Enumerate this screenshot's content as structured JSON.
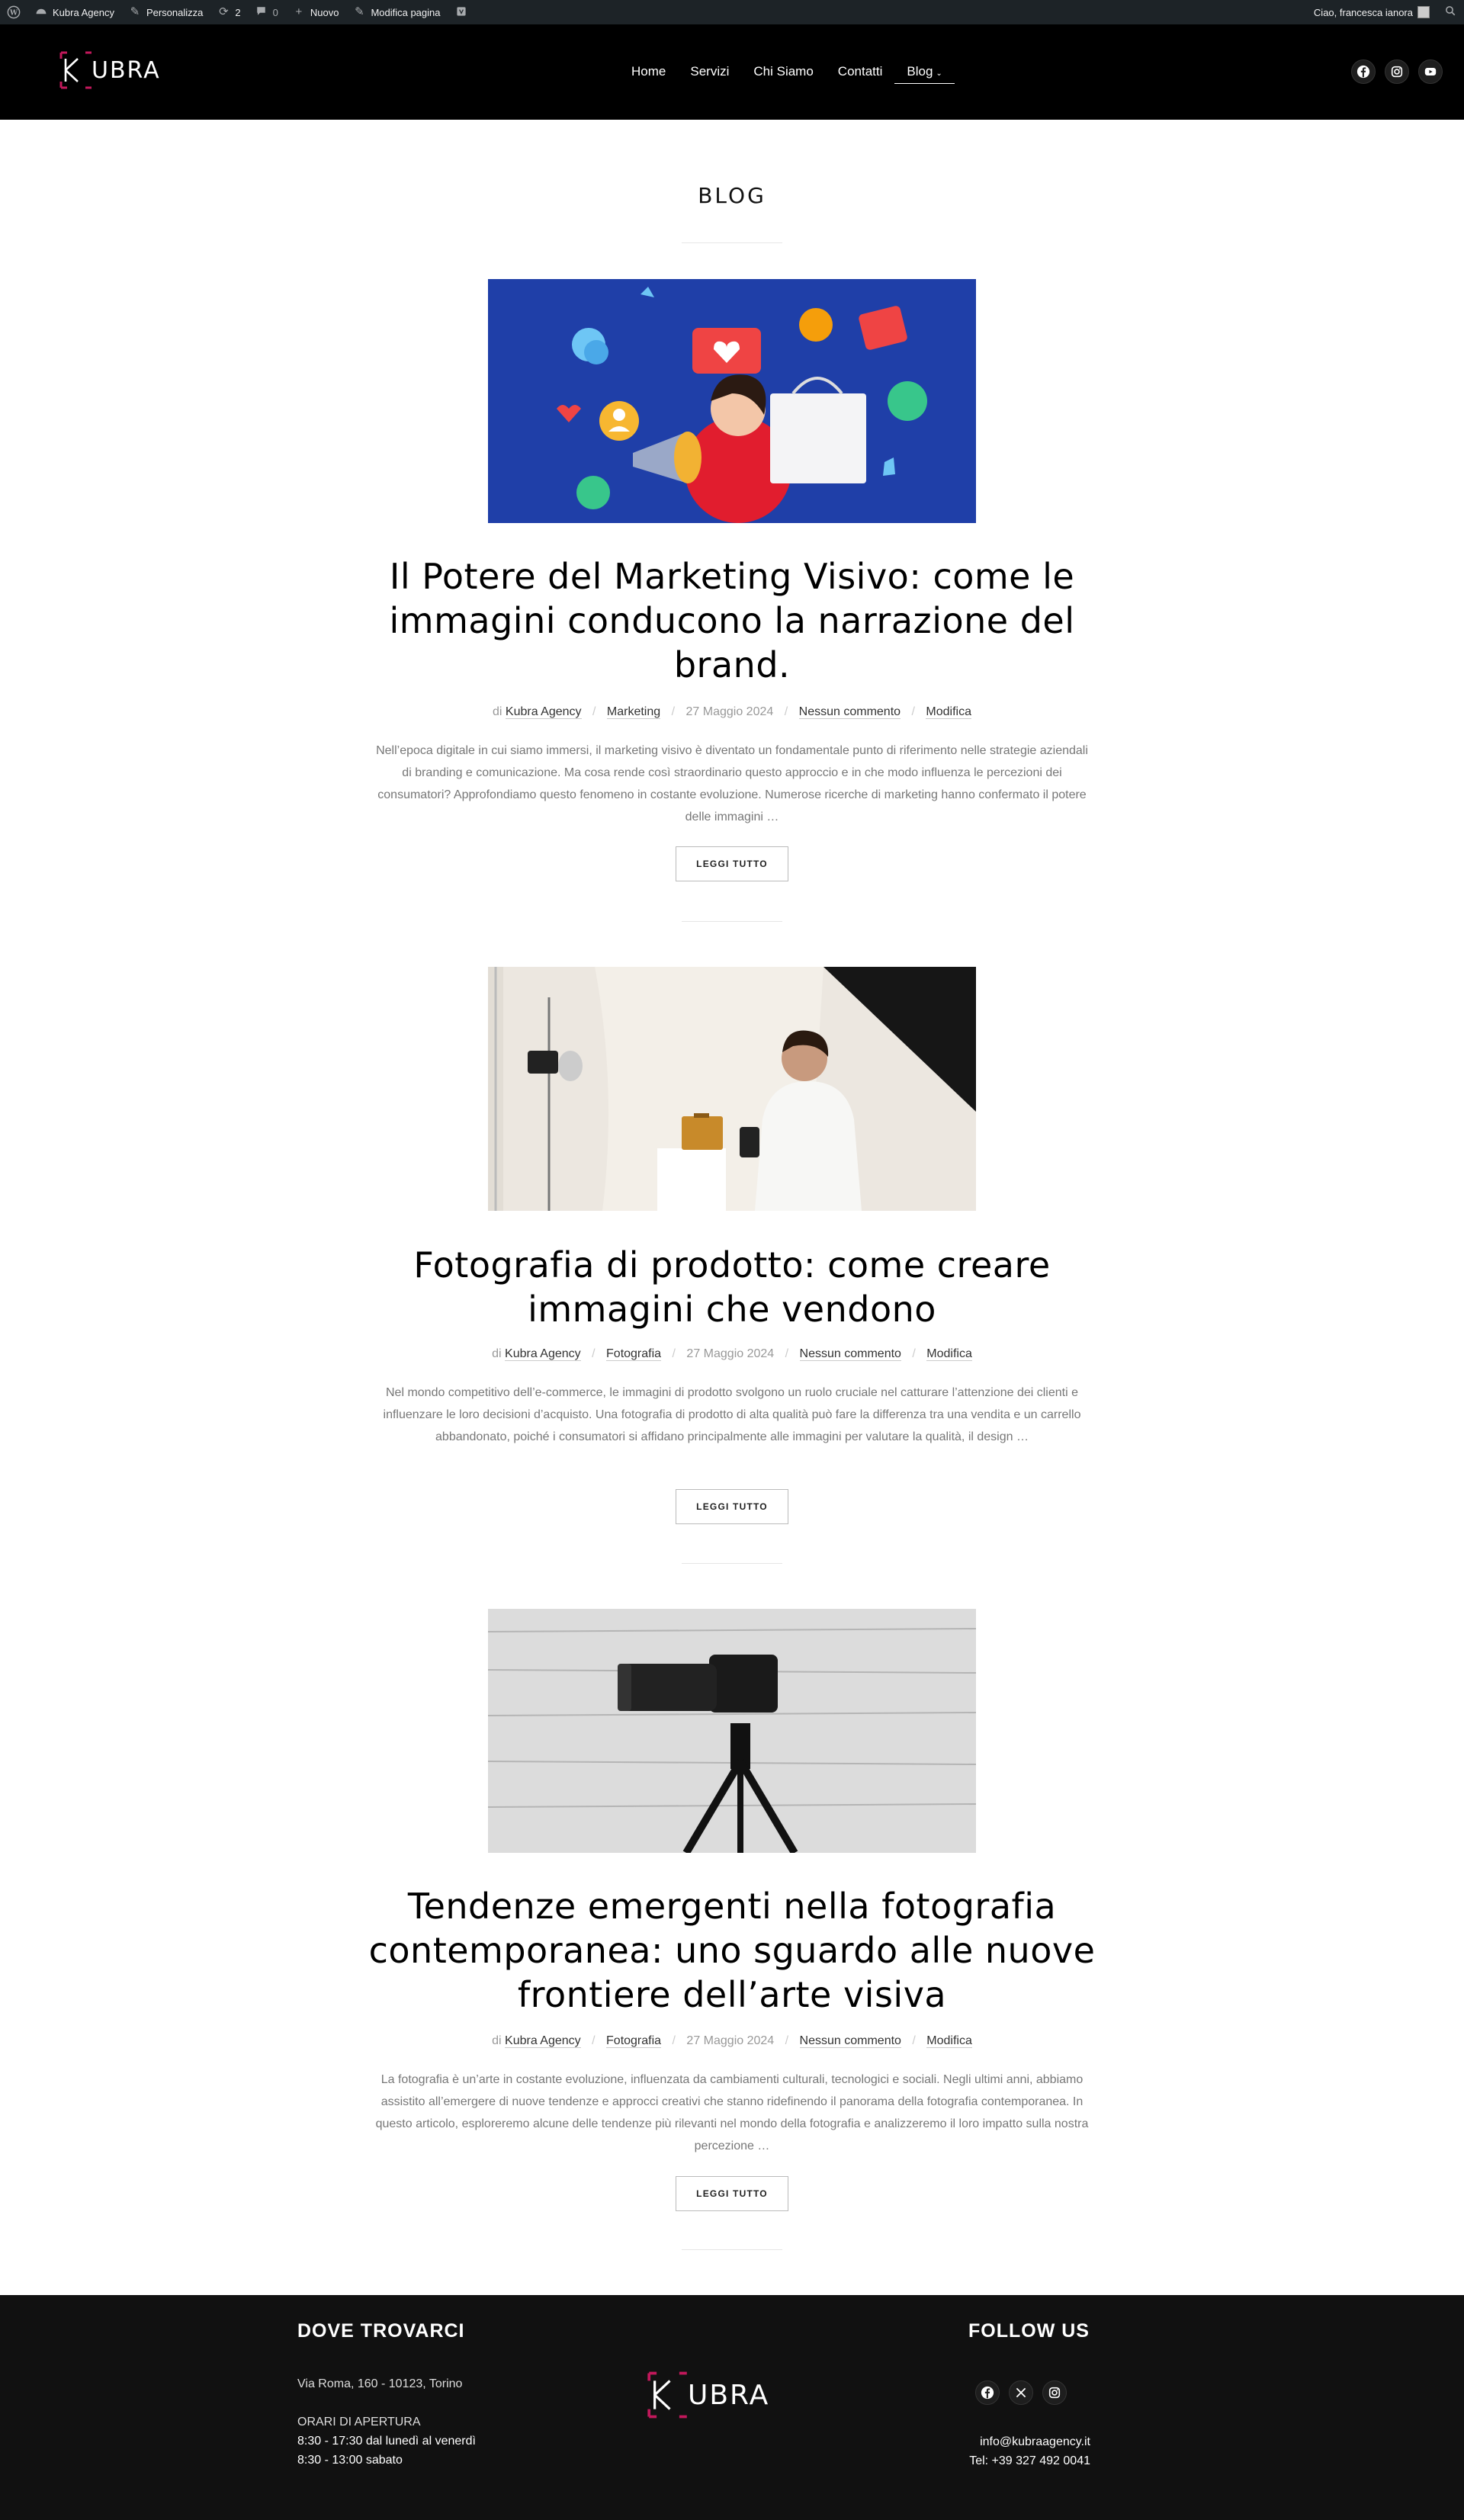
{
  "admin_bar": {
    "site_name": "Kubra Agency",
    "customize": "Personalizza",
    "updates_count": "2",
    "comments_count": "0",
    "new": "Nuovo",
    "edit_page": "Modifica pagina",
    "greeting": "Ciao, francesca ianora"
  },
  "header": {
    "logo_text": "UBRA",
    "nav": [
      {
        "label": "Home"
      },
      {
        "label": "Servizi"
      },
      {
        "label": "Chi Siamo"
      },
      {
        "label": "Contatti"
      },
      {
        "label": "Blog"
      }
    ],
    "socials": [
      "facebook-icon",
      "instagram-icon",
      "youtube-icon"
    ]
  },
  "page": {
    "title": "BLOG"
  },
  "posts": [
    {
      "title": "Il Potere del Marketing Visivo: come le immagini conducono la narrazione del brand.",
      "by": "di",
      "author": "Kubra Agency",
      "category": "Marketing",
      "date": "27 Maggio 2024",
      "comments": "Nessun commento",
      "edit": "Modifica",
      "excerpt": "Nell’epoca digitale in cui siamo immersi, il marketing visivo è diventato un fondamentale punto di riferimento nelle strategie aziendali di branding e comunicazione. Ma cosa rende così straordinario questo approccio e in che modo influenza le percezioni dei consumatori? Approfondiamo questo fenomeno in costante evoluzione. Numerose ricerche di marketing hanno confermato il potere delle immagini …",
      "button": "LEGGI TUTTO"
    },
    {
      "title": "Fotografia di prodotto: come creare immagini che vendono",
      "by": "di",
      "author": "Kubra Agency",
      "category": "Fotografia",
      "date": "27 Maggio 2024",
      "comments": "Nessun commento",
      "edit": "Modifica",
      "excerpt": "Nel mondo competitivo dell’e-commerce, le immagini di prodotto svolgono un ruolo cruciale nel catturare l’attenzione dei clienti e influenzare le loro decisioni d’acquisto. Una fotografia di prodotto di alta qualità può fare la differenza tra una vendita e un carrello abbandonato, poiché i consumatori si affidano principalmente alle immagini per valutare la qualità, il design …",
      "button": "LEGGI TUTTO"
    },
    {
      "title": "Tendenze emergenti nella fotografia contemporanea: uno sguardo alle nuove frontiere dell’arte visiva",
      "by": "di",
      "author": "Kubra Agency",
      "category": "Fotografia",
      "date": "27 Maggio 2024",
      "comments": "Nessun commento",
      "edit": "Modifica",
      "excerpt": "La fotografia è un’arte in costante evoluzione, influenzata da cambiamenti culturali, tecnologici e sociali. Negli ultimi anni, abbiamo assistito all’emergere di nuove tendenze e approcci creativi che stanno ridefinendo il panorama della fotografia contemporanea. In questo articolo, esploreremo alcune delle tendenze più rilevanti nel mondo della fotografia e analizzeremo il loro impatto sulla nostra percezione …",
      "button": "LEGGI TUTTO"
    }
  ],
  "footer": {
    "left_heading": "DOVE TROVARCI",
    "address": "Via Roma, 160 - 10123, Torino",
    "hours_title": "ORARI DI APERTURA",
    "hours_weekday": "8:30 - 17:30 dal lunedì al venerdì",
    "hours_saturday": "8:30 - 13:00 sabato",
    "logo_text": "UBRA",
    "right_heading": "FOLLOW US",
    "email": "info@kubraagency.it",
    "phone": "Tel: +39 327 492 0041",
    "socials": [
      "facebook-icon",
      "x-icon",
      "instagram-icon"
    ]
  },
  "colors": {
    "accent": "#c2185b",
    "header_bg": "#000000",
    "footer_bg": "#111111",
    "adminbar_bg": "#1d2327",
    "image1_bg": "#1f3fa8"
  }
}
